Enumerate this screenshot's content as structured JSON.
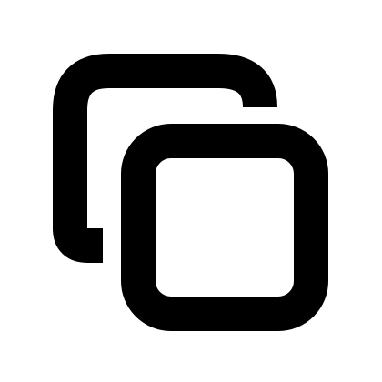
{
  "icon": {
    "name": "copy-icon",
    "color": "#000000",
    "background": "#ffffff"
  }
}
